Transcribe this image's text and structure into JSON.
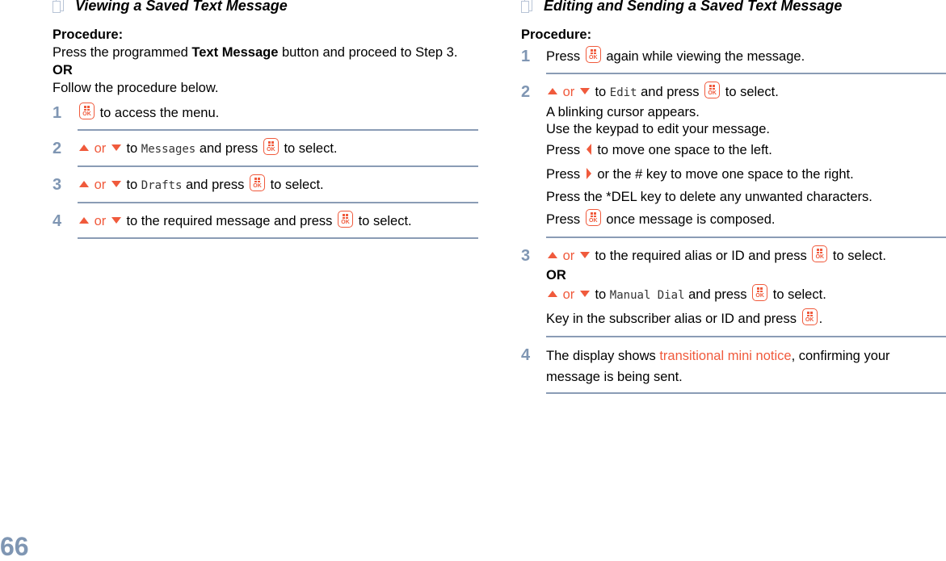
{
  "page_number": "66",
  "colors": {
    "accent": "#f05a3c",
    "step_number": "#7f96b3",
    "divider": "#8a9cb5"
  },
  "left": {
    "heading": "Viewing a Saved Text Message",
    "procedure_label": "Procedure:",
    "intro_1a": "Press the programmed ",
    "intro_1b": "Text Message",
    "intro_1c": " button and proceed to Step 3.",
    "or_label": "OR",
    "intro_2": "Follow the procedure below.",
    "steps": [
      {
        "num": "1",
        "text_after_ok": " to access the menu."
      },
      {
        "num": "2",
        "or": "or",
        "to": " to ",
        "item": "Messages",
        "mid": " and press ",
        "end": " to select."
      },
      {
        "num": "3",
        "or": "or",
        "to": " to ",
        "item": "Drafts",
        "mid": " and press ",
        "end": " to select."
      },
      {
        "num": "4",
        "or": "or",
        "text": " to the required message and press ",
        "end": " to select."
      }
    ]
  },
  "right": {
    "heading": "Editing and Sending a Saved Text Message",
    "procedure_label": "Procedure:",
    "steps": [
      {
        "num": "1",
        "a": "Press ",
        "b": " again while viewing the message."
      },
      {
        "num": "2",
        "or": "or",
        "to": " to ",
        "item": "Edit",
        "mid": " and press ",
        "end": " to select.",
        "lines": {
          "cursor": "A blinking cursor appears.",
          "keypad": "Use the keypad to edit your message.",
          "left_a": "Press ",
          "left_b": " to move one space to the left.",
          "right_a": "Press ",
          "right_b": " or the # key to move one space to the right.",
          "del": "Press the *DEL key to delete any unwanted characters.",
          "composed_a": "Press ",
          "composed_b": " once message is composed."
        }
      },
      {
        "num": "3",
        "or": "or",
        "text": " to the required alias or ID and press ",
        "end": " to select.",
        "or_label": "OR",
        "alt_to": " to ",
        "alt_item": "Manual Dial",
        "alt_mid": " and press ",
        "alt_end": " to select.",
        "key_in": "Key in the subscriber alias or ID and press ",
        "key_in_end": "."
      },
      {
        "num": "4",
        "a": "The display shows  ",
        "notice": "transitional mini notice",
        "b": ", confirming your message is being sent."
      }
    ]
  },
  "icons": {
    "ok_label": "OK"
  }
}
